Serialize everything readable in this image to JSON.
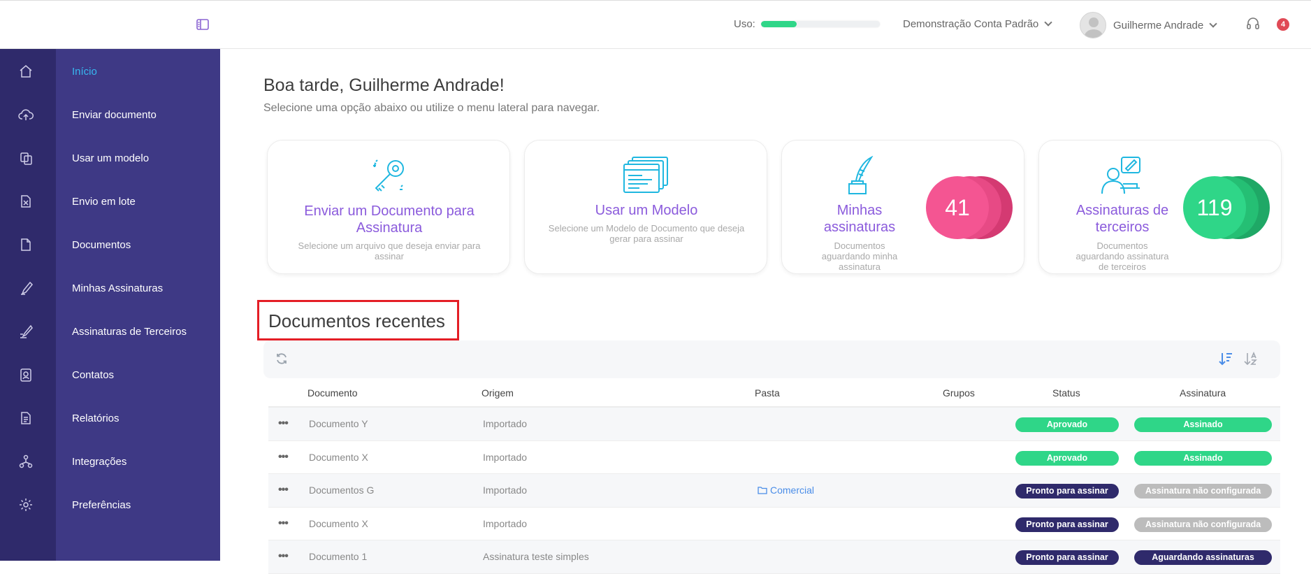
{
  "topbar": {
    "uso_label": "Uso:",
    "uso_fraction": 0.3,
    "account_label": "Demonstração Conta Padrão",
    "user_name": "Guilherme Andrade",
    "notifications_count": "4"
  },
  "sidebar": {
    "items": [
      {
        "label": "Início",
        "icon": "home-icon",
        "active": true
      },
      {
        "label": "Enviar documento",
        "icon": "cloud-upload-icon"
      },
      {
        "label": "Usar um modelo",
        "icon": "template-icon"
      },
      {
        "label": "Envio em lote",
        "icon": "batch-file-icon"
      },
      {
        "label": "Documentos",
        "icon": "document-icon"
      },
      {
        "label": "Minhas Assinaturas",
        "icon": "pen-icon"
      },
      {
        "label": "Assinaturas de Terceiros",
        "icon": "third-party-sign-icon"
      },
      {
        "label": "Contatos",
        "icon": "contacts-icon"
      },
      {
        "label": "Relatórios",
        "icon": "reports-icon"
      },
      {
        "label": "Integrações",
        "icon": "integrations-icon"
      },
      {
        "label": "Preferências",
        "icon": "gear-icon"
      }
    ]
  },
  "main": {
    "greeting": "Boa tarde, Guilherme Andrade!",
    "subtitle": "Selecione uma opção abaixo ou utilize o menu lateral para navegar.",
    "cards": [
      {
        "title": "Enviar um Documento para Assinatura",
        "desc": "Selecione um arquivo que deseja enviar para assinar"
      },
      {
        "title": "Usar um Modelo",
        "desc": "Selecione um Modelo de Documento que deseja gerar para assinar"
      },
      {
        "title": "Minhas assinaturas",
        "desc": "Documentos aguardando minha assinatura",
        "count": "41"
      },
      {
        "title": "Assinaturas de terceiros",
        "desc": "Documentos aguardando assinatura de terceiros",
        "count": "119"
      }
    ],
    "recent_title": "Documentos recentes",
    "table": {
      "headers": [
        "Documento",
        "Origem",
        "Pasta",
        "Grupos",
        "Status",
        "Assinatura"
      ],
      "rows": [
        {
          "doc": "Documento Y",
          "origin": "Importado",
          "folder": "",
          "status": "Aprovado",
          "status_kind": "green",
          "sign": "Assinado",
          "sign_kind": "green"
        },
        {
          "doc": "Documento X",
          "origin": "Importado",
          "folder": "",
          "status": "Aprovado",
          "status_kind": "green",
          "sign": "Assinado",
          "sign_kind": "green"
        },
        {
          "doc": "Documentos G",
          "origin": "Importado",
          "folder": "Comercial",
          "status": "Pronto para assinar",
          "status_kind": "navy",
          "sign": "Assinatura não configurada",
          "sign_kind": "grey"
        },
        {
          "doc": "Documento X",
          "origin": "Importado",
          "folder": "",
          "status": "Pronto para assinar",
          "status_kind": "navy",
          "sign": "Assinatura não configurada",
          "sign_kind": "grey"
        },
        {
          "doc": "Documento 1",
          "origin": "Assinatura teste simples",
          "folder": "",
          "status": "Pronto para assinar",
          "status_kind": "navy",
          "sign": "Aguardando assinaturas",
          "sign_kind": "navy"
        }
      ]
    }
  }
}
